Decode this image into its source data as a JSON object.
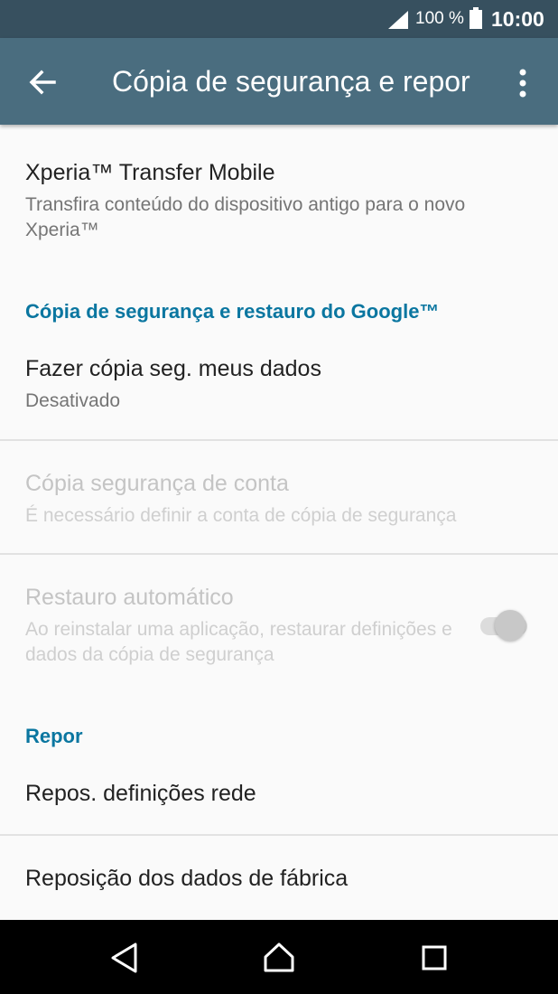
{
  "status_bar": {
    "battery_percent": "100 %",
    "time": "10:00",
    "signal_icon": "signal-icon",
    "battery_icon": "battery-icon"
  },
  "app_bar": {
    "title": "Cópia de segurança e repor",
    "back_icon": "arrow-back-icon",
    "menu_icon": "more-vert-icon"
  },
  "items": {
    "transfer": {
      "title": "Xperia™ Transfer Mobile",
      "subtitle": "Transfira conteúdo do dispositivo antigo para o novo Xperia™"
    },
    "google_header": "Cópia de segurança e restauro do Google™",
    "backup_data": {
      "title": "Fazer cópia seg. meus dados",
      "subtitle": "Desativado"
    },
    "backup_account": {
      "title": "Cópia segurança de conta",
      "subtitle": "É necessário definir a conta de cópia de segurança",
      "enabled": false
    },
    "auto_restore": {
      "title": "Restauro automático",
      "subtitle": "Ao reinstalar uma aplicação, restaurar definições e dados da cópia de segurança",
      "enabled": false,
      "toggle_on": true
    },
    "reset_header": "Repor",
    "reset_network": {
      "title": "Repos. definições rede"
    },
    "factory_reset": {
      "title": "Reposição dos dados de fábrica"
    }
  },
  "nav_bar": {
    "back_icon": "nav-back-icon",
    "home_icon": "nav-home-icon",
    "recents_icon": "nav-recents-icon"
  },
  "colors": {
    "status_bar": "#37505f",
    "app_bar": "#4a6d7f",
    "accent": "#0a76a0",
    "background": "#fafafa"
  }
}
